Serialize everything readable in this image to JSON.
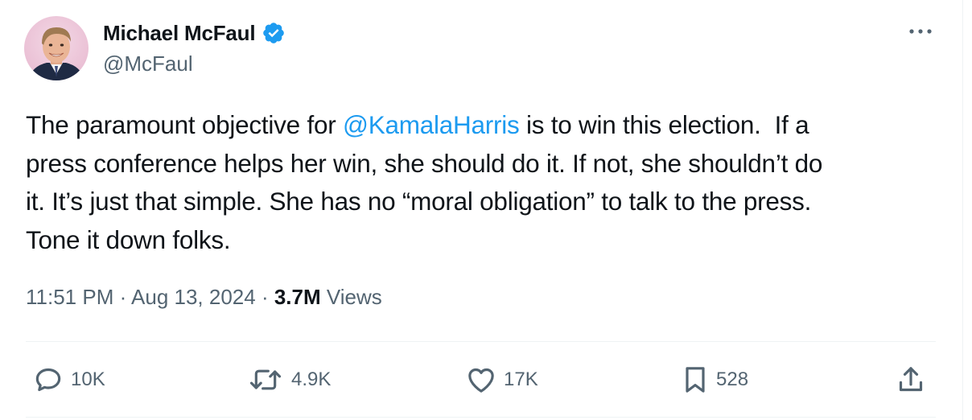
{
  "author": {
    "display_name": "Michael McFaul",
    "handle": "@McFaul",
    "verified_icon": "verified-badge-icon",
    "avatar": "profile-photo"
  },
  "more_icon": "more-horizontal-icon",
  "tweet": {
    "lines": [
      {
        "before": "The paramount objective for ",
        "mention": "@KamalaHarris",
        "after": " is to win this election.  If a"
      },
      {
        "text": "press conference helps her win, she should do it. If not, she shouldn’t do"
      },
      {
        "text": "it. It’s just that simple. She has no “moral obligation” to talk to the press."
      },
      {
        "text": "Tone it down folks."
      }
    ]
  },
  "meta": {
    "time": "11:51 PM",
    "separator": " · ",
    "date": "Aug 13, 2024",
    "views_count": "3.7M",
    "views_label": " Views"
  },
  "actions": {
    "reply": {
      "icon": "reply-icon",
      "count": "10K"
    },
    "retweet": {
      "icon": "retweet-icon",
      "count": "4.9K"
    },
    "like": {
      "icon": "heart-icon",
      "count": "17K"
    },
    "bookmark": {
      "icon": "bookmark-icon",
      "count": "528"
    },
    "share": {
      "icon": "share-icon"
    }
  },
  "colors": {
    "text": "#0f1419",
    "secondary": "#536471",
    "accent": "#1d9bf0",
    "divider": "#eff3f4"
  }
}
